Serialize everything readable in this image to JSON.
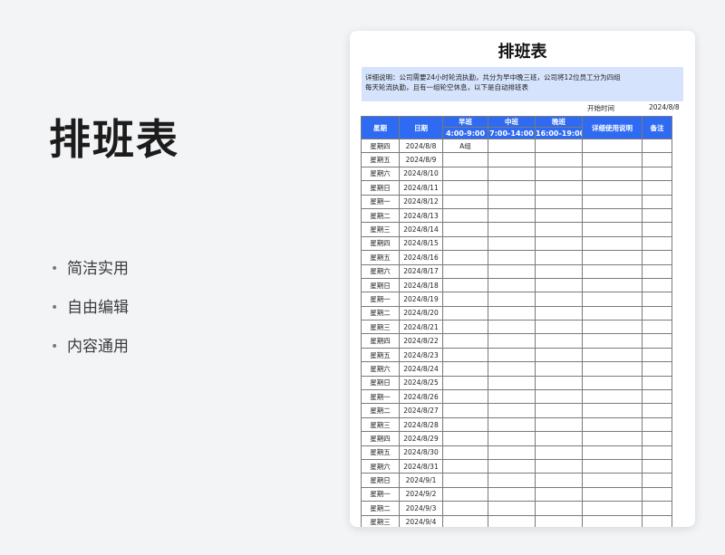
{
  "slide": {
    "title": "排班表",
    "features": [
      "简洁实用",
      "自由编辑",
      "内容通用"
    ]
  },
  "sheet": {
    "title": "排班表",
    "description_line1": "详细说明：公司需要24小时轮流执勤，共分为早中晚三班，公司将12位员工分为四组",
    "description_line2": "每天轮流执勤，且有一组轮空休息，以下是自动排班表",
    "start_label": "开始时间",
    "start_date": "2024/8/8",
    "headers": {
      "weekday": "星期",
      "date": "日期",
      "morning": "早班",
      "morning_time": "4:00-9:00",
      "mid": "中班",
      "mid_time": "7:00-14:00",
      "night": "晚班",
      "night_time": "16:00-19:00",
      "detail": "详细使用说明",
      "note": "备注"
    },
    "rows": [
      {
        "weekday": "星期四",
        "date": "2024/8/8",
        "morning": "A组"
      },
      {
        "weekday": "星期五",
        "date": "2024/8/9"
      },
      {
        "weekday": "星期六",
        "date": "2024/8/10"
      },
      {
        "weekday": "星期日",
        "date": "2024/8/11"
      },
      {
        "weekday": "星期一",
        "date": "2024/8/12"
      },
      {
        "weekday": "星期二",
        "date": "2024/8/13"
      },
      {
        "weekday": "星期三",
        "date": "2024/8/14"
      },
      {
        "weekday": "星期四",
        "date": "2024/8/15"
      },
      {
        "weekday": "星期五",
        "date": "2024/8/16"
      },
      {
        "weekday": "星期六",
        "date": "2024/8/17"
      },
      {
        "weekday": "星期日",
        "date": "2024/8/18"
      },
      {
        "weekday": "星期一",
        "date": "2024/8/19"
      },
      {
        "weekday": "星期二",
        "date": "2024/8/20"
      },
      {
        "weekday": "星期三",
        "date": "2024/8/21"
      },
      {
        "weekday": "星期四",
        "date": "2024/8/22"
      },
      {
        "weekday": "星期五",
        "date": "2024/8/23"
      },
      {
        "weekday": "星期六",
        "date": "2024/8/24"
      },
      {
        "weekday": "星期日",
        "date": "2024/8/25"
      },
      {
        "weekday": "星期一",
        "date": "2024/8/26"
      },
      {
        "weekday": "星期二",
        "date": "2024/8/27"
      },
      {
        "weekday": "星期三",
        "date": "2024/8/28"
      },
      {
        "weekday": "星期四",
        "date": "2024/8/29"
      },
      {
        "weekday": "星期五",
        "date": "2024/8/30"
      },
      {
        "weekday": "星期六",
        "date": "2024/8/31"
      },
      {
        "weekday": "星期日",
        "date": "2024/9/1"
      },
      {
        "weekday": "星期一",
        "date": "2024/9/2"
      },
      {
        "weekday": "星期二",
        "date": "2024/9/3"
      },
      {
        "weekday": "星期三",
        "date": "2024/9/4"
      }
    ]
  },
  "colors": {
    "header_bg": "#2f6bf2",
    "description_bg": "#d6e3fc",
    "page_bg": "#f3f4f6"
  }
}
